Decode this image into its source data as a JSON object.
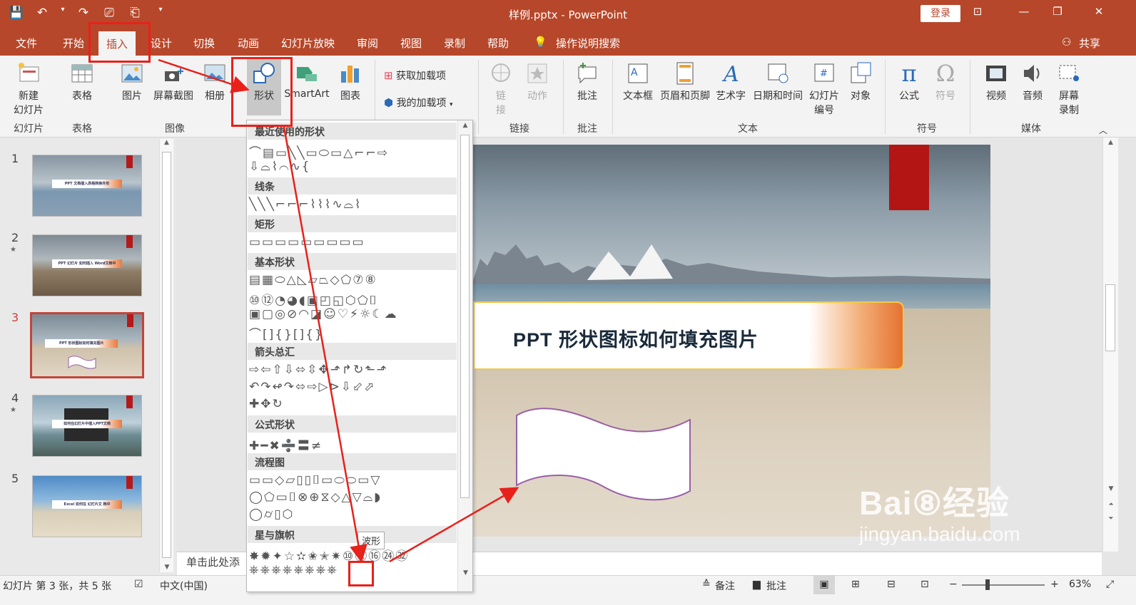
{
  "titlebar": {
    "doc_title": "样例.pptx - PowerPoint",
    "login": "登录",
    "qat": [
      "💾",
      "↶",
      "▾",
      "↷",
      "⎚",
      "⎗",
      "▾"
    ],
    "win": [
      "⊡",
      "—",
      "❐",
      "✕"
    ]
  },
  "tabs": [
    "文件",
    "开始",
    "插入",
    "设计",
    "切换",
    "动画",
    "幻灯片放映",
    "审阅",
    "视图",
    "录制",
    "帮助"
  ],
  "active_tab": "插入",
  "tell_me": "操作说明搜索",
  "share": "共享",
  "ribbon": {
    "new_slide": "新建\n幻灯片",
    "table": "表格",
    "picture": "图片",
    "screenshot": "屏幕截图",
    "album": "相册",
    "shapes": "形状",
    "smartart": "SmartArt",
    "chart": "图表",
    "get_addins": "获取加载项",
    "my_addins": "我的加载项",
    "link": "链\n接",
    "action": "动作",
    "comment": "批注",
    "textbox": "文本框",
    "header_footer": "页眉和页脚",
    "wordart": "艺术字",
    "datetime": "日期和时间",
    "slide_number": "幻灯片\n编号",
    "object": "对象",
    "equation": "公式",
    "symbol": "符号",
    "video": "视频",
    "audio": "音频",
    "screen_record": "屏幕\n录制",
    "groups": [
      "幻灯片",
      "表格",
      "图像",
      "链接",
      "批注",
      "文本",
      "符号",
      "媒体"
    ]
  },
  "thumbnails": [
    {
      "num": "1",
      "text": "PPT 文档插入表格转换外形"
    },
    {
      "num": "2",
      "text": "PPT 幻灯片 如何插入 Word文档中"
    },
    {
      "num": "3",
      "text": "PPT 形状图标如何填充图片"
    },
    {
      "num": "4",
      "text": "如何在幻灯片中插入PPT文档"
    },
    {
      "num": "5",
      "text": "Excel 如何在 幻灯片文 档中"
    }
  ],
  "selected_slide": "3",
  "slide": {
    "title": "PPT 形状图标如何填充图片"
  },
  "notes_placeholder": "单击此处添",
  "shapes_dropdown": {
    "categories": [
      "最近使用的形状",
      "线条",
      "矩形",
      "基本形状",
      "箭头总汇",
      "公式形状",
      "流程图",
      "星与旗帜"
    ],
    "rows": {
      "recent1": "⌒▤▭╲╲▭⬭▭△⌐⌐⇨",
      "recent2": "⇩⌓⌇⌒∿{",
      "lines": "╲╲╲⌐⌐⌐⌇⌇⌇∿⌓⌇",
      "rect": "▭▭▭▭▭▭▭▭▭",
      "basic1": "▤▦⬭△◺▱⏢◇⬠⑦⑧",
      "basic2": "⑩⑫◔◕◖▣◰◱⬡⬠⌷",
      "basic3": "▣▢◎⊘◠◪☺♡⚡☼☾☁",
      "basic4": "⌒[]{}[]{}",
      "arrows1": "⇨⇦⇧⇩⬄⇳✥⬏↱↻⬑⬏",
      "arrows2": "↶↷↫↷⬄⇨▷⊳⇩⬃⬀",
      "arrows3": "✚✥↻",
      "math": "✚━✖➗〓≠",
      "flow1": "▭▭◇▱▯▯⌷▭⬭⬭▭▽",
      "flow2": "◯⬠▭⌷⊗⊕⧖◇△▽⌓◗",
      "flow3": "◯⌭▯⬡",
      "stars1": "✸✹✦☆✫✬✭✷⑩⑫⑯㉔㉜",
      "stars2": "⎈⎈⎈⎈⎈⎈⎈⎈"
    },
    "tooltip": "波形"
  },
  "status": {
    "slide_info": "幻灯片 第 3 张，共 5 张",
    "language": "中文(中国)",
    "notes": "备注",
    "comments": "批注",
    "zoom": "63%"
  },
  "watermark": {
    "line1": "Bai⑧经验",
    "line2": "jingyan.baidu.com"
  },
  "colors": {
    "accent": "#b7472a",
    "highlight": "#e8211b"
  }
}
